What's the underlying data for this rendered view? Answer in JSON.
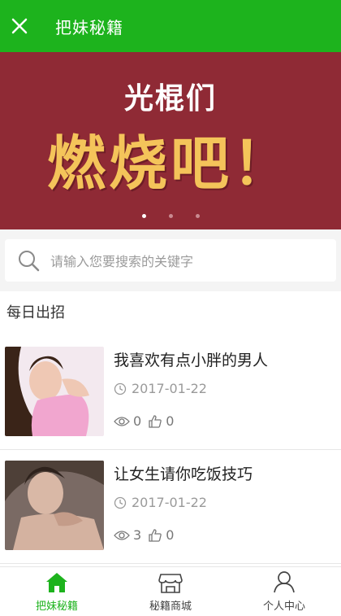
{
  "header": {
    "title": "把妹秘籍",
    "close_icon": "close-icon"
  },
  "banner": {
    "subtitle": "光棍们",
    "headline": "燃烧吧！",
    "dots_total": 3,
    "dots_active": 1
  },
  "search": {
    "placeholder": "请输入您要搜索的关键字",
    "icon": "search-icon"
  },
  "section": {
    "title": "每日出招"
  },
  "articles": [
    {
      "title": "我喜欢有点小胖的男人",
      "date": "2017-01-22",
      "views": "0",
      "likes": "0"
    },
    {
      "title": "让女生请你吃饭技巧",
      "date": "2017-01-22",
      "views": "3",
      "likes": "0"
    }
  ],
  "tabbar": {
    "items": [
      {
        "label": "把妹秘籍",
        "icon": "home-icon",
        "active": true
      },
      {
        "label": "秘籍商城",
        "icon": "store-icon",
        "active": false
      },
      {
        "label": "个人中心",
        "icon": "user-icon",
        "active": false
      }
    ]
  },
  "colors": {
    "accent": "#1db31d",
    "banner_bg": "#8f2a35",
    "banner_text": "#f4c45a"
  }
}
